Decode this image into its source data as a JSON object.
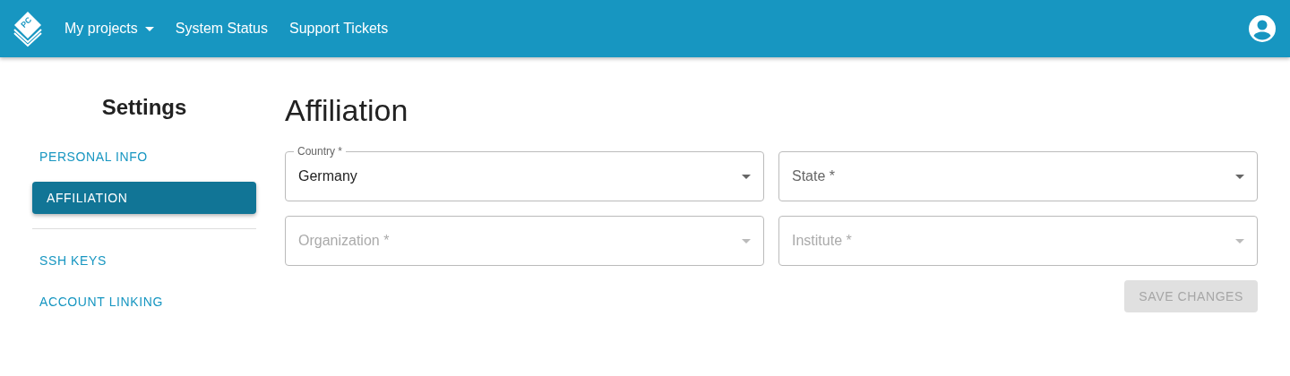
{
  "navbar": {
    "logo_text": "PC",
    "menu": [
      {
        "label": "My projects",
        "dropdown": true
      },
      {
        "label": "System Status",
        "dropdown": false
      },
      {
        "label": "Support Tickets",
        "dropdown": false
      }
    ]
  },
  "sidebar": {
    "title": "Settings",
    "groups": [
      [
        {
          "label": "PERSONAL INFO",
          "selected": false
        },
        {
          "label": "AFFILIATION",
          "selected": true
        }
      ],
      [
        {
          "label": "SSH KEYS",
          "selected": false
        },
        {
          "label": "ACCOUNT LINKING",
          "selected": false
        }
      ]
    ]
  },
  "page": {
    "title": "Affiliation",
    "fields": [
      {
        "label": "Country *",
        "value": "Germany",
        "disabled": false
      },
      {
        "label": "State *",
        "disabled": false
      },
      {
        "label": "Organization *",
        "disabled": true
      },
      {
        "label": "Institute *",
        "disabled": true
      }
    ],
    "save_button": {
      "label": "SAVE CHANGES",
      "disabled": true
    }
  }
}
